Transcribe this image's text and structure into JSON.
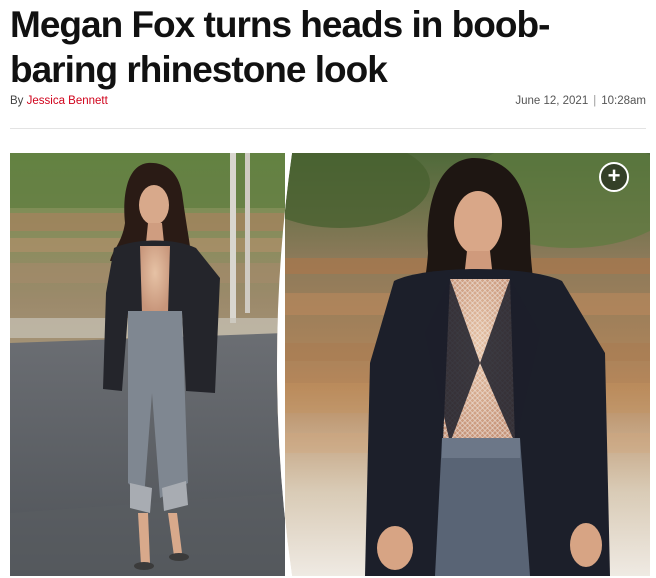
{
  "article": {
    "headline": "Megan Fox turns heads in boob-baring rhinestone look",
    "byline_prefix": "By ",
    "author": "Jessica Bennett",
    "date": "June 12, 2021",
    "separator": "|",
    "time": "10:28am"
  },
  "gallery": {
    "expand_icon": "plus-icon"
  },
  "colors": {
    "author_link": "#d0021b",
    "headline": "#111111"
  }
}
